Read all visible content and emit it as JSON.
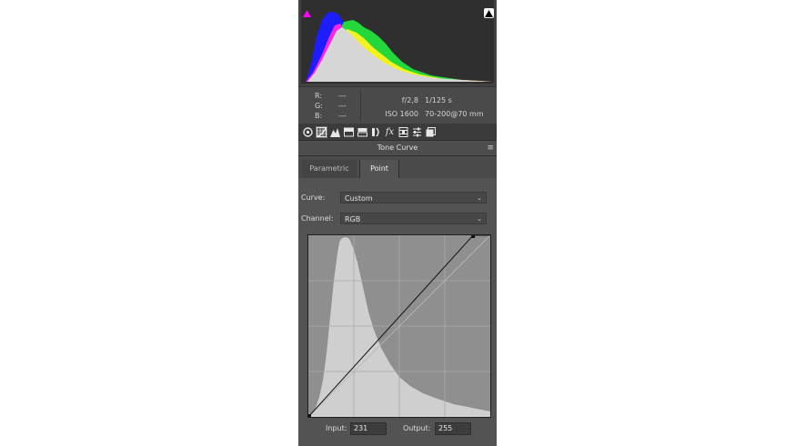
{
  "histogram": {
    "shadow_clip_color": "#ff00ff",
    "highlight_clip_color": "#000000"
  },
  "readout": {
    "r_label": "R:",
    "r_value": "---",
    "g_label": "G:",
    "g_value": "---",
    "b_label": "B:",
    "b_value": "---",
    "aperture": "f/2,8",
    "shutter": "1/125 s",
    "iso": "ISO 1600",
    "lens": "70-200@70 mm"
  },
  "toolbar": {
    "icons": [
      "basic-icon",
      "tone-curve-icon",
      "detail-icon",
      "hsl-icon",
      "split-toning-icon",
      "lens-corrections-icon",
      "effects-icon",
      "camera-calibration-icon",
      "presets-icon",
      "snapshots-icon"
    ],
    "active_index": 1,
    "fx_glyph": "fx"
  },
  "panel": {
    "title": "Tone Curve",
    "menu_glyph": "≡"
  },
  "tabs": [
    {
      "label": "Parametric",
      "active": false
    },
    {
      "label": "Point",
      "active": true
    }
  ],
  "point": {
    "curve_label": "Curve:",
    "curve_value": "Custom",
    "channel_label": "Channel:",
    "channel_value": "RGB",
    "input_label": "Input:",
    "input_value": "231",
    "output_label": "Output:",
    "output_value": "255"
  },
  "curve_points": [
    [
      0,
      0
    ],
    [
      231,
      255
    ]
  ]
}
